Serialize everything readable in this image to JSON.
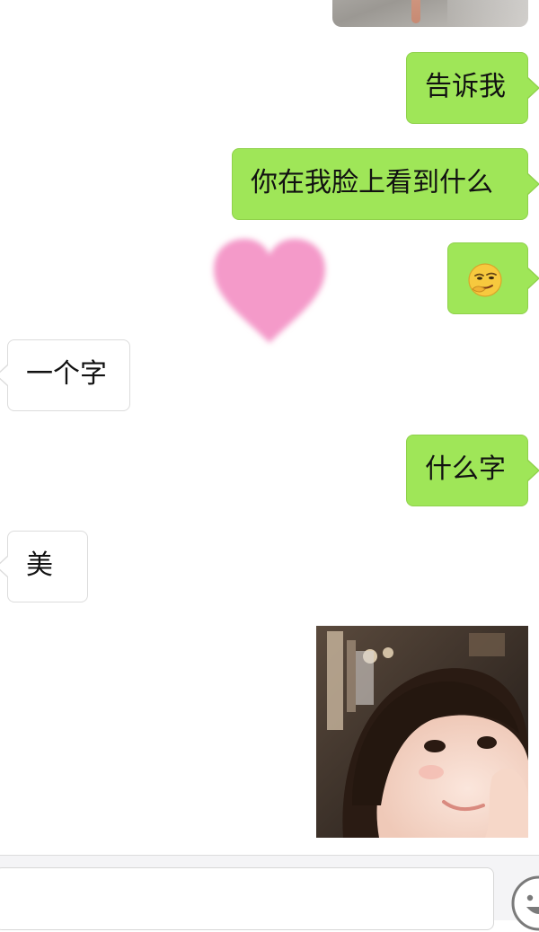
{
  "messages": {
    "m1": "告诉我",
    "m2": "你在我脸上看到什么",
    "m3_emoji": "smirk-emoji",
    "m4": "一个字",
    "m5": "什么字",
    "m6": "美"
  },
  "stickers": {
    "heart_color": "#f49ac9"
  },
  "colors": {
    "sent_bubble": "#9fe658",
    "received_bubble": "#ffffff",
    "background": "#ffffff",
    "input_bar": "#f4f4f6"
  },
  "input": {
    "value": "",
    "placeholder": ""
  },
  "icons": {
    "emoji_button": "smiley-face-icon"
  }
}
